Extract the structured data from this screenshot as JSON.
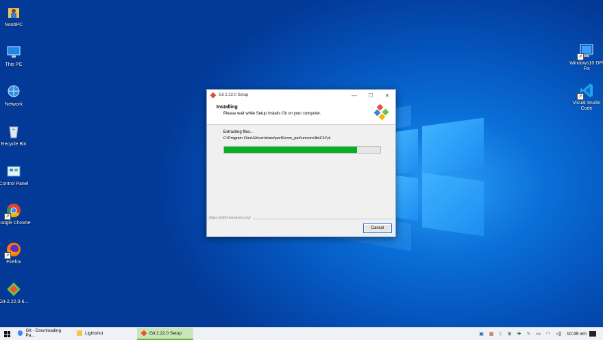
{
  "desktop": {
    "icons_left": [
      {
        "label": "NoobPC",
        "icon": "user-folder-icon"
      },
      {
        "label": "This PC",
        "icon": "computer-icon"
      },
      {
        "label": "Network",
        "icon": "network-icon"
      },
      {
        "label": "Recycle Bin",
        "icon": "recycle-bin-icon"
      },
      {
        "label": "Control Panel",
        "icon": "control-panel-icon"
      },
      {
        "label": "Google Chrome",
        "icon": "chrome-icon"
      },
      {
        "label": "Firefox",
        "icon": "firefox-icon"
      },
      {
        "label": "Git-2.22.0-6...",
        "icon": "git-installer-icon"
      }
    ],
    "icons_right": [
      {
        "label": "Windows10 DPI Fix",
        "icon": "monitor-icon"
      },
      {
        "label": "Visual Studio Code",
        "icon": "vscode-icon"
      }
    ]
  },
  "dialog": {
    "title": "Git 2.22.0 Setup",
    "minimize": "—",
    "maximize": "☐",
    "close": "✕",
    "heading": "Installing",
    "subheading": "Please wait while Setup installs Git on your computer.",
    "status": "Extracting files...",
    "current_file": "C:\\Program Files\\Git\\usr\\share\\perl5\\core_perl\\unicore\\lib\\CI\\Y.pl",
    "progress": 0.85,
    "url": "https://gitforwindows.org/",
    "cancel_label": "Cancel"
  },
  "taskbar": {
    "items": [
      {
        "label": "Git - Downloading Pa...",
        "icon": "chrome-icon",
        "color": "#4285f4"
      },
      {
        "label": "Lightshot",
        "icon": "folder-icon",
        "color": "#f2c94c"
      },
      {
        "label": "Git 2.22.0 Setup",
        "icon": "git-icon",
        "color": "#f05032",
        "active": true
      }
    ],
    "clock": "10:49 am"
  },
  "colors": {
    "accent": "#06b025",
    "taskbar_active": "#c8e6b8"
  }
}
